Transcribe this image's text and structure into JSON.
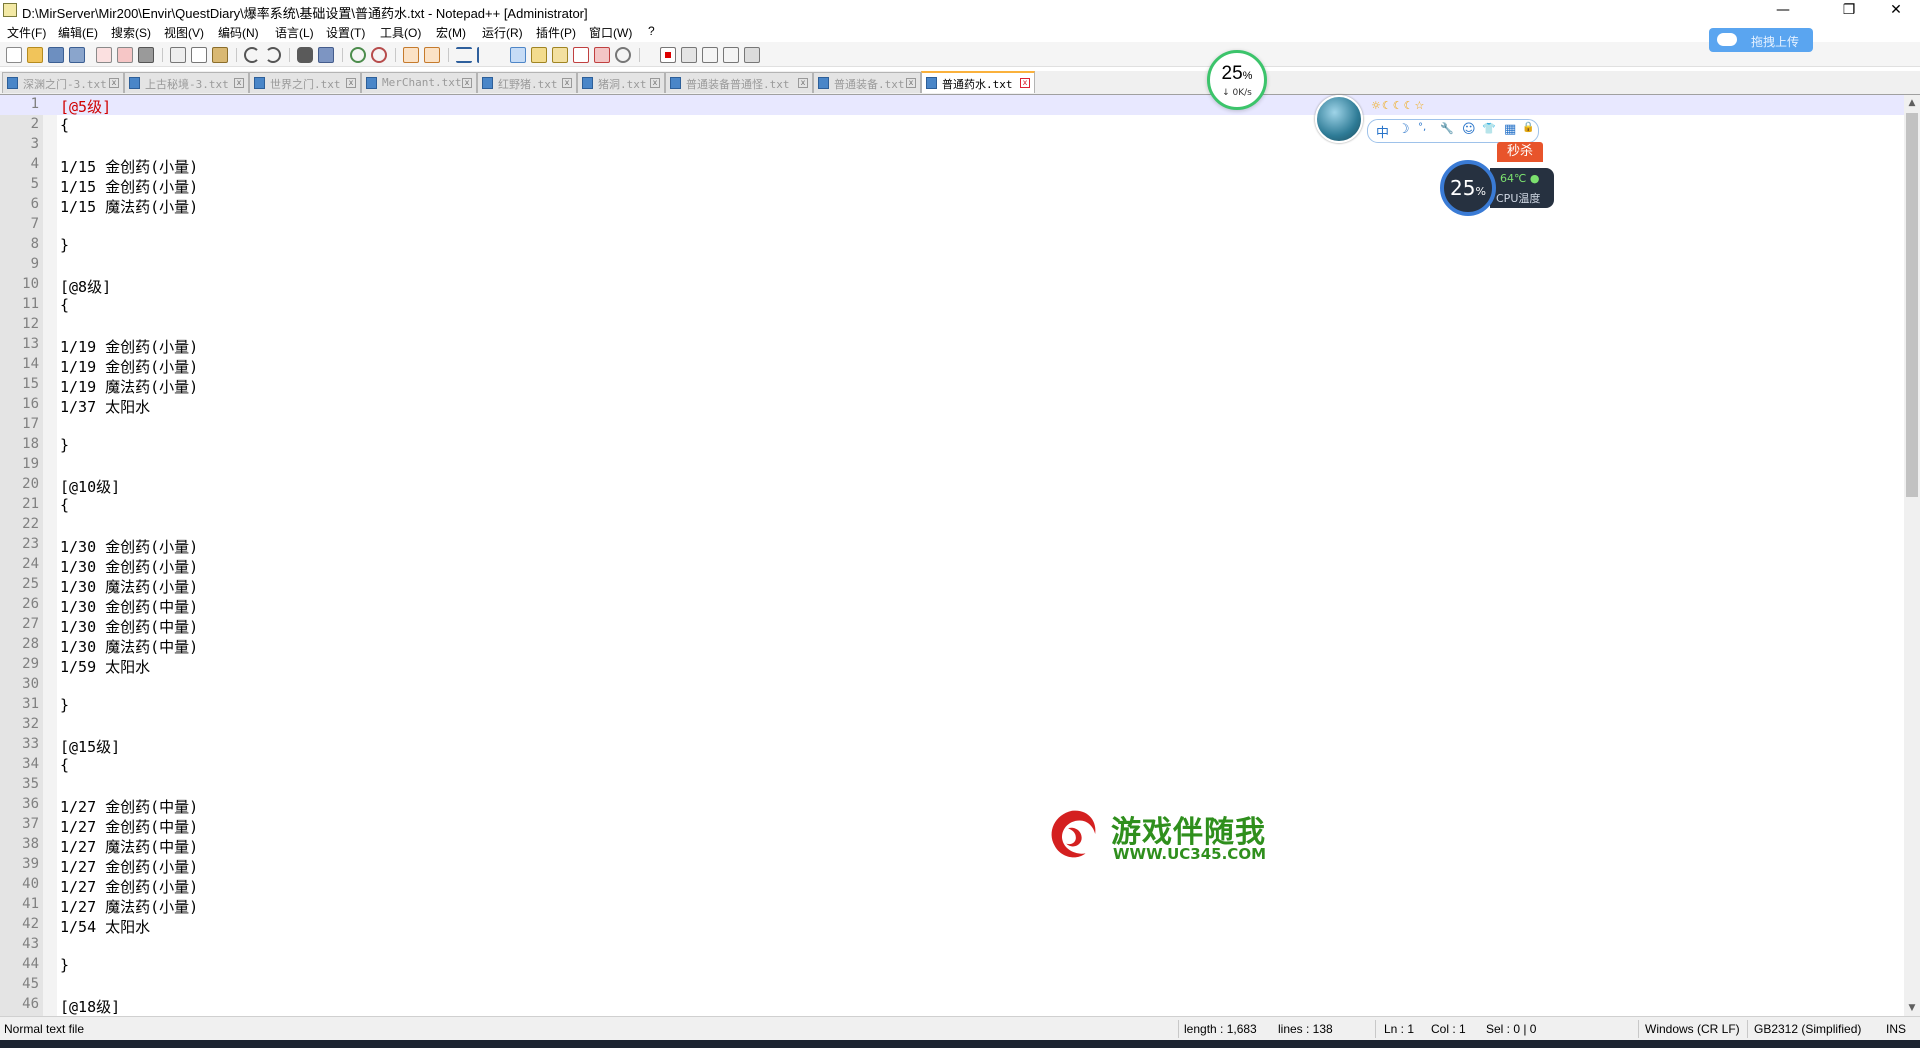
{
  "window": {
    "title": "D:\\MirServer\\Mir200\\Envir\\QuestDiary\\爆率系统\\基础设置\\普通药水.txt - Notepad++ [Administrator]",
    "minimize_glyph": "—",
    "maximize_glyph": "❐",
    "close_glyph": "✕"
  },
  "menu": [
    "文件(F)",
    "编辑(E)",
    "搜索(S)",
    "视图(V)",
    "编码(N)",
    "语言(L)",
    "设置(T)",
    "工具(O)",
    "宏(M)",
    "运行(R)",
    "插件(P)",
    "窗口(W)",
    "?"
  ],
  "toolbar_icons": [
    "new-file-icon",
    "open-file-icon",
    "save-icon",
    "save-all-icon",
    "close-file-icon",
    "close-all-icon",
    "print-icon",
    "cut-icon",
    "copy-icon",
    "paste-icon",
    "undo-icon",
    "redo-icon",
    "find-icon",
    "replace-icon",
    "zoom-in-icon",
    "zoom-out-icon",
    "sync-vertical-icon",
    "sync-horizontal-icon",
    "word-wrap-icon",
    "show-all-chars-icon",
    "indent-guide-icon",
    "user-language-icon",
    "doc-map-icon",
    "function-list-icon",
    "folder-workspace-icon",
    "monitoring-icon",
    "record-macro-icon",
    "stop-macro-icon",
    "play-macro-icon",
    "run-macro-multiple-icon",
    "save-macro-icon"
  ],
  "tabs": [
    {
      "label": "深渊之门-3.txt",
      "active": false
    },
    {
      "label": "上古秘境-3.txt",
      "active": false
    },
    {
      "label": "世界之门.txt",
      "active": false
    },
    {
      "label": "MerChant.txt",
      "active": false
    },
    {
      "label": "红野猪.txt",
      "active": false
    },
    {
      "label": "猪洞.txt",
      "active": false
    },
    {
      "label": "普通装备普通怪.txt",
      "active": false
    },
    {
      "label": "普通装备.txt",
      "active": false
    },
    {
      "label": "普通药水.txt",
      "active": true
    }
  ],
  "editor": {
    "current_line": 1,
    "lines": [
      "[@5级]",
      "{",
      "",
      "1/15 金创药(小量)",
      "1/15 金创药(小量)",
      "1/15 魔法药(小量)",
      "",
      "}",
      "",
      "[@8级]",
      "{",
      "",
      "1/19 金创药(小量)",
      "1/19 金创药(小量)",
      "1/19 魔法药(小量)",
      "1/37 太阳水",
      "",
      "}",
      "",
      "[@10级]",
      "{",
      "",
      "1/30 金创药(小量)",
      "1/30 金创药(小量)",
      "1/30 魔法药(小量)",
      "1/30 金创药(中量)",
      "1/30 金创药(中量)",
      "1/30 魔法药(中量)",
      "1/59 太阳水",
      "",
      "}",
      "",
      "[@15级]",
      "{",
      "",
      "1/27 金创药(中量)",
      "1/27 金创药(中量)",
      "1/27 魔法药(中量)",
      "1/27 金创药(小量)",
      "1/27 金创药(小量)",
      "1/27 魔法药(小量)",
      "1/54 太阳水",
      "",
      "}",
      "",
      "[@18级]"
    ]
  },
  "statusbar": {
    "file_type": "Normal text file",
    "length": "length : 1,683",
    "lines": "lines : 138",
    "ln": "Ln : 1",
    "col": "Col : 1",
    "sel": "Sel : 0 | 0",
    "eol": "Windows (CR LF)",
    "encoding": "GB2312 (Simplified)",
    "mode": "INS"
  },
  "overlays": {
    "net_meter": {
      "percent": "25",
      "percent_unit": "%",
      "speed": "↓ 0K/s",
      "accent": "#3cc46b"
    },
    "upload_button": "拖拽上传",
    "ime": {
      "lang": "中",
      "moon": "☽",
      "punct": "°,",
      "wrench": "🔧",
      "smile": "☺",
      "shirt": "👕",
      "grid": "▦",
      "lock": "🔒",
      "stars": "☼☾☾☾☆"
    },
    "cpu": {
      "percent": "25",
      "percent_unit": "%",
      "temp": "64℃",
      "label": "CPU温度"
    },
    "miaosha": "秒杀",
    "watermark": {
      "title": "游戏伴随我",
      "url": "WWW.UC345.COM",
      "color": "#2f8f1d"
    }
  },
  "colors": {
    "tab_active_accent": "#fab13c",
    "current_line_bg": "#e8e8ff",
    "current_line_text": "#d00000",
    "gutter_bg": "#e4e4e4"
  }
}
